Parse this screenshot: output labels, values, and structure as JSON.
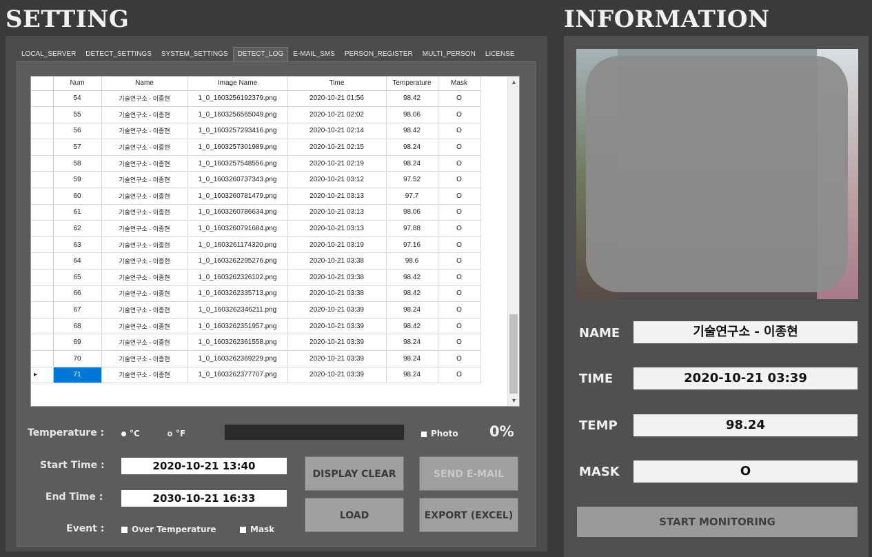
{
  "setting_title": "SETTING",
  "info_title": "INFORMATION",
  "tabs": [
    "LOCAL_SERVER",
    "DETECT_SETTINGS",
    "SYSTEM_SETTINGS",
    "DETECT_LOG",
    "E-MAIL_SMS",
    "PERSON_REGISTER",
    "MULTI_PERSON",
    "LICENSE"
  ],
  "active_tab": "DETECT_LOG",
  "table": {
    "columns": [
      "Num",
      "Name",
      "Image Name",
      "Time",
      "Temperature",
      "Mask"
    ],
    "rows": [
      [
        "54",
        "기술연구소 - 이종현",
        "1_0_1603256192379.png",
        "2020-10-21 01:56",
        "98.42",
        "O"
      ],
      [
        "55",
        "기술연구소 - 이종현",
        "1_0_1603256565049.png",
        "2020-10-21 02:02",
        "98.06",
        "O"
      ],
      [
        "56",
        "기술연구소 - 이종현",
        "1_0_1603257293416.png",
        "2020-10-21 02:14",
        "98.42",
        "O"
      ],
      [
        "57",
        "기술연구소 - 이종현",
        "1_0_1603257301989.png",
        "2020-10-21 02:15",
        "98.24",
        "O"
      ],
      [
        "58",
        "기술연구소 - 이종현",
        "1_0_1603257548556.png",
        "2020-10-21 02:19",
        "98.24",
        "O"
      ],
      [
        "59",
        "기술연구소 - 이종현",
        "1_0_1603260737343.png",
        "2020-10-21 03:12",
        "97.52",
        "O"
      ],
      [
        "60",
        "기술연구소 - 이종현",
        "1_0_1603260781479.png",
        "2020-10-21 03:13",
        "97.7",
        "O"
      ],
      [
        "61",
        "기술연구소 - 이종현",
        "1_0_1603260786634.png",
        "2020-10-21 03:13",
        "98.06",
        "O"
      ],
      [
        "62",
        "기술연구소 - 이종현",
        "1_0_1603260791684.png",
        "2020-10-21 03:13",
        "97.88",
        "O"
      ],
      [
        "63",
        "기술연구소 - 이종현",
        "1_0_1603261174320.png",
        "2020-10-21 03:19",
        "97.16",
        "O"
      ],
      [
        "64",
        "기술연구소 - 이종현",
        "1_0_1603262295276.png",
        "2020-10-21 03:38",
        "98.6",
        "O"
      ],
      [
        "65",
        "기술연구소 - 이종현",
        "1_0_1603262326102.png",
        "2020-10-21 03:38",
        "98.42",
        "O"
      ],
      [
        "66",
        "기술연구소 - 이종현",
        "1_0_1603262335713.png",
        "2020-10-21 03:38",
        "98.42",
        "O"
      ],
      [
        "67",
        "기술연구소 - 이종현",
        "1_0_1603262346211.png",
        "2020-10-21 03:39",
        "98.24",
        "O"
      ],
      [
        "68",
        "기술연구소 - 이종현",
        "1_0_1603262351957.png",
        "2020-10-21 03:39",
        "98.42",
        "O"
      ],
      [
        "69",
        "기술연구소 - 이종현",
        "1_0_1603262361558.png",
        "2020-10-21 03:39",
        "98.24",
        "O"
      ],
      [
        "70",
        "기술연구소 - 이종현",
        "1_0_1603262369229.png",
        "2020-10-21 03:39",
        "98.24",
        "O"
      ],
      [
        "71",
        "기술연구소 - 이종현",
        "1_0_1603262377707.png",
        "2020-10-21 03:39",
        "98.24",
        "O"
      ]
    ],
    "selected_num": "71"
  },
  "temperature": {
    "label": "Temperature :",
    "celsius": "°C",
    "fahrenheit": "°F",
    "selected_unit": "°C"
  },
  "photo_checkbox": "Photo",
  "progress_percent": "0%",
  "progress_value": 0,
  "start_time": {
    "label": "Start Time :",
    "value": "2020-10-21 13:40"
  },
  "end_time": {
    "label": "End Time :",
    "value": "2030-10-21 16:33"
  },
  "event": {
    "label": "Event :",
    "over_temperature": "Over Temperature",
    "mask": "Mask"
  },
  "buttons": {
    "display_clear": "DISPLAY CLEAR",
    "send_email": "SEND E-MAIL",
    "load": "LOAD",
    "export_excel": "EXPORT (EXCEL)",
    "start_monitoring": "START MONITORING"
  },
  "info": {
    "name_label": "NAME",
    "name_value": "기술연구소 - 이종현",
    "time_label": "TIME",
    "time_value": "2020-10-21 03:39",
    "temp_label": "TEMP",
    "temp_value": "98.24",
    "mask_label": "MASK",
    "mask_value": "O"
  }
}
